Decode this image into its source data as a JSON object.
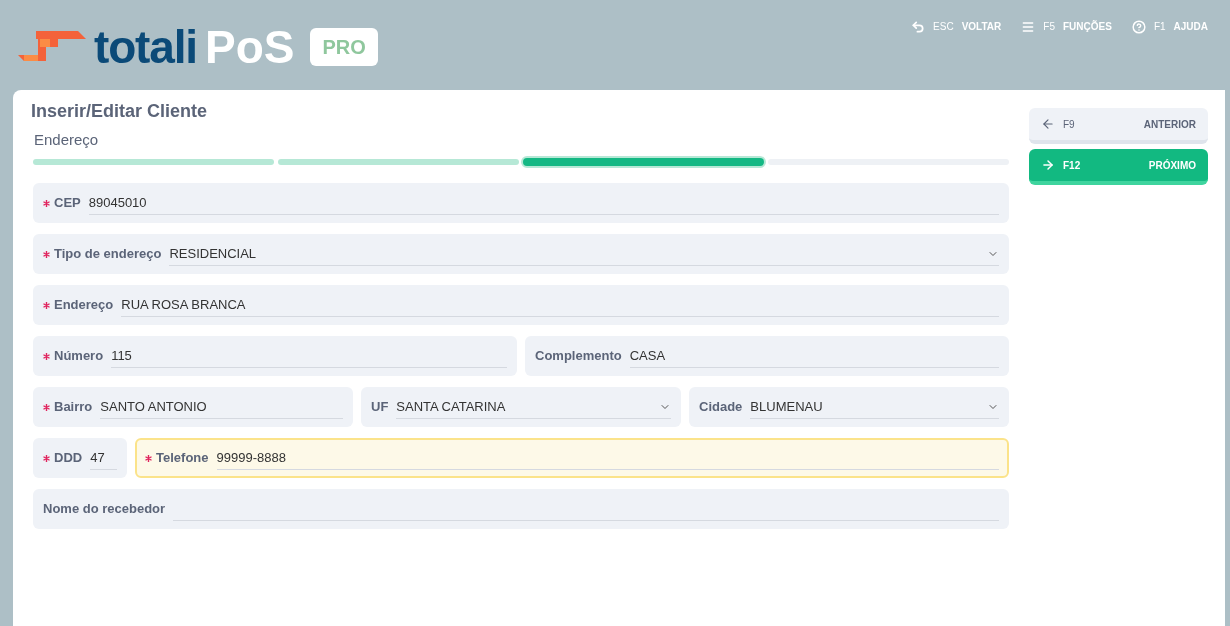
{
  "logo": {
    "brand": "totali",
    "product": "PoS",
    "edition": "PRO"
  },
  "shortcuts": [
    {
      "kind": "back",
      "key": "ESC",
      "label": "VOLTAR"
    },
    {
      "kind": "menu",
      "key": "F5",
      "label": "FUNÇÕES"
    },
    {
      "kind": "help",
      "key": "F1",
      "label": "AJUDA"
    }
  ],
  "title": "Inserir/Editar Cliente",
  "step_title": "Endereço",
  "steps": [
    {
      "completed": true,
      "selected": false
    },
    {
      "completed": true,
      "selected": false
    },
    {
      "completed": false,
      "selected": true
    },
    {
      "completed": false,
      "selected": false
    }
  ],
  "rows": [
    [
      {
        "kind": "text",
        "required": true,
        "label": "CEP",
        "value": "89045010",
        "focused": false
      }
    ],
    [
      {
        "kind": "select",
        "required": true,
        "label": "Tipo de endereço",
        "value": "RESIDENCIAL",
        "focused": false
      }
    ],
    [
      {
        "kind": "text",
        "required": true,
        "label": "Endereço",
        "value": "RUA ROSA BRANCA",
        "focused": false
      }
    ],
    [
      {
        "kind": "text",
        "required": true,
        "label": "Número",
        "value": "115",
        "focused": false
      },
      {
        "kind": "text",
        "required": false,
        "label": "Complemento",
        "value": "CASA",
        "focused": false
      }
    ],
    [
      {
        "kind": "text",
        "required": true,
        "label": "Bairro",
        "value": "SANTO ANTONIO",
        "focused": false
      },
      {
        "kind": "select",
        "required": false,
        "label": "UF",
        "value": "SANTA CATARINA",
        "focused": false
      },
      {
        "kind": "select",
        "required": false,
        "label": "Cidade",
        "value": "BLUMENAU",
        "focused": false
      }
    ],
    [
      {
        "kind": "short",
        "required": true,
        "label": "DDD",
        "value": "47",
        "focused": false
      },
      {
        "kind": "text",
        "required": true,
        "label": "Telefone",
        "value": "99999-8888",
        "focused": true
      }
    ],
    [
      {
        "kind": "text",
        "required": false,
        "label": "Nome do recebedor",
        "focused": false
      }
    ]
  ],
  "nav_buttons": [
    {
      "kind": "prev",
      "key": "F9",
      "label": "ANTERIOR"
    },
    {
      "kind": "next",
      "key": "F12",
      "label": "PRÓXIMO"
    }
  ]
}
